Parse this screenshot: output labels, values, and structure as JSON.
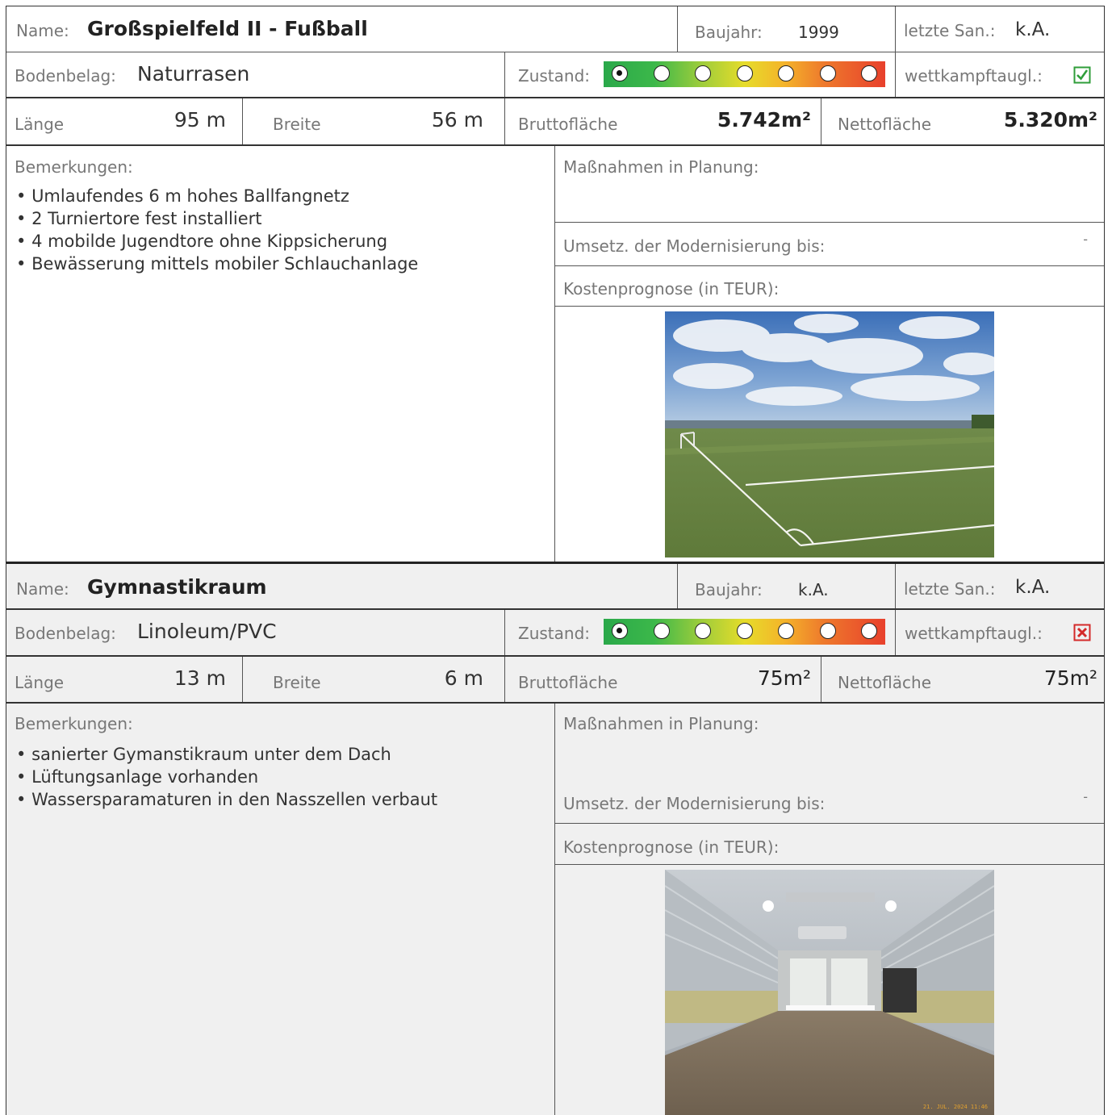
{
  "entries": [
    {
      "name_label": "Name:",
      "name": "Großspielfeld II - Fußball",
      "baujahr_label": "Baujahr:",
      "baujahr": "1999",
      "san_label": "letzte San.:",
      "san": "k.A.",
      "boden_label": "Bodenbelag:",
      "boden": "Naturrasen",
      "zustand_label": "Zustand:",
      "zustand_level": 1,
      "zustand_steps": 7,
      "wett_label": "wettkampftaugl.:",
      "wett_ok": true,
      "laenge_label": "Länge",
      "laenge": "95 m",
      "breite_label": "Breite",
      "breite": "56 m",
      "brutto_label": "Bruttofläche",
      "brutto": "5.742m²",
      "netto_label": "Nettofläche",
      "netto": "5.320m²",
      "bem_label": "Bemerkungen:",
      "bemerkungen": [
        "Umlaufendes 6 m hohes Ballfangnetz",
        "2 Turniertore fest installiert",
        "4 mobilde Jugendtore ohne Kippsicherung",
        "Bewässerung mittels mobiler Schlauchanlage"
      ],
      "mass_label": "Maßnahmen in Planung:",
      "umsetz_label": "Umsetz. der Modernisierung bis:",
      "umsetz": "-",
      "kosten_label": "Kostenprognose (in TEUR):"
    },
    {
      "name_label": "Name:",
      "name": "Gymnastikraum",
      "baujahr_label": "Baujahr:",
      "baujahr": "k.A.",
      "san_label": "letzte San.:",
      "san": "k.A.",
      "boden_label": "Bodenbelag:",
      "boden": "Linoleum/PVC",
      "zustand_label": "Zustand:",
      "zustand_level": 1,
      "zustand_steps": 7,
      "wett_label": "wettkampftaugl.:",
      "wett_ok": false,
      "laenge_label": "Länge",
      "laenge": "13 m",
      "breite_label": "Breite",
      "breite": "6 m",
      "brutto_label": "Bruttofläche",
      "brutto": "75m²",
      "netto_label": "Nettofläche",
      "netto": "75m²",
      "bem_label": "Bemerkungen:",
      "bemerkungen": [
        "sanierter Gymanstikraum unter dem Dach",
        "Lüftungsanlage vorhanden",
        "Wassersparamaturen in den Nasszellen verbaut"
      ],
      "mass_label": "Maßnahmen in Planung:",
      "umsetz_label": "Umsetz. der Modernisierung bis:",
      "umsetz": "-",
      "kosten_label": "Kostenprognose (in TEUR):",
      "photo_timestamp": "21. JUL. 2024 11:46"
    }
  ],
  "colors": {
    "check_ok": "#2f9e3a",
    "check_fail": "#d42a2a"
  }
}
